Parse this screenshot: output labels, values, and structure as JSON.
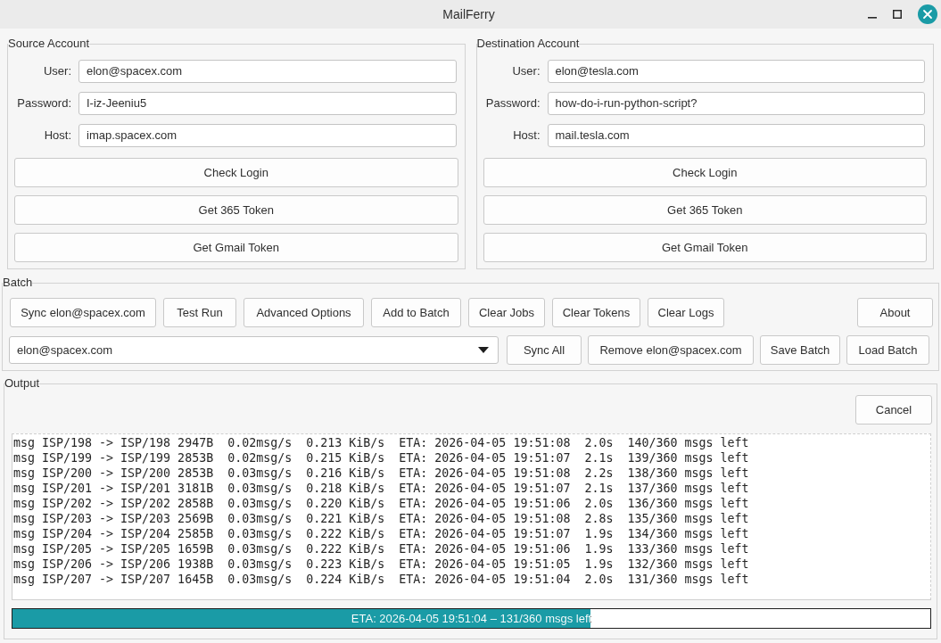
{
  "window": {
    "title": "MailFerry"
  },
  "source_account": {
    "title": "Source Account",
    "fields": [
      {
        "label": "User:",
        "value": "elon@spacex.com"
      },
      {
        "label": "Password:",
        "value": "I-iz-Jeeniu5"
      },
      {
        "label": "Host:",
        "value": "imap.spacex.com"
      }
    ],
    "buttons": [
      "Check Login",
      "Get 365 Token",
      "Get Gmail Token"
    ]
  },
  "destination_account": {
    "title": "Destination Account",
    "fields": [
      {
        "label": "User:",
        "value": "elon@tesla.com"
      },
      {
        "label": "Password:",
        "value": "how-do-i-run-python-script?"
      },
      {
        "label": "Host:",
        "value": "mail.tesla.com"
      }
    ],
    "buttons": [
      "Check Login",
      "Get 365 Token",
      "Get Gmail Token"
    ]
  },
  "batch": {
    "title": "Batch",
    "toolbar_buttons": [
      "Sync elon@spacex.com",
      "Test Run",
      "Advanced Options",
      "Add to Batch",
      "Clear Jobs",
      "Clear Tokens",
      "Clear Logs"
    ],
    "about_button": "About",
    "job_select": {
      "value": "elon@spacex.com"
    },
    "job_buttons": [
      "Sync All",
      "Remove elon@spacex.com",
      "Save Batch",
      "Load Batch"
    ]
  },
  "output": {
    "title": "Output",
    "cancel_button": "Cancel",
    "log_lines": [
      "msg ISP/198 -> ISP/198 2947B  0.02msg/s  0.213 KiB/s  ETA: 2026-04-05 19:51:08  2.0s  140/360 msgs left",
      "msg ISP/199 -> ISP/199 2853B  0.02msg/s  0.215 KiB/s  ETA: 2026-04-05 19:51:07  2.1s  139/360 msgs left",
      "msg ISP/200 -> ISP/200 2853B  0.03msg/s  0.216 KiB/s  ETA: 2026-04-05 19:51:08  2.2s  138/360 msgs left",
      "msg ISP/201 -> ISP/201 3181B  0.03msg/s  0.218 KiB/s  ETA: 2026-04-05 19:51:07  2.1s  137/360 msgs left",
      "msg ISP/202 -> ISP/202 2858B  0.03msg/s  0.220 KiB/s  ETA: 2026-04-05 19:51:06  2.0s  136/360 msgs left",
      "msg ISP/203 -> ISP/203 2569B  0.03msg/s  0.221 KiB/s  ETA: 2026-04-05 19:51:08  2.8s  135/360 msgs left",
      "msg ISP/204 -> ISP/204 2585B  0.03msg/s  0.222 KiB/s  ETA: 2026-04-05 19:51:07  1.9s  134/360 msgs left",
      "msg ISP/205 -> ISP/205 1659B  0.03msg/s  0.222 KiB/s  ETA: 2026-04-05 19:51:06  1.9s  133/360 msgs left",
      "msg ISP/206 -> ISP/206 1938B  0.03msg/s  0.223 KiB/s  ETA: 2026-04-05 19:51:05  1.9s  132/360 msgs left",
      "msg ISP/207 -> ISP/207 1645B  0.03msg/s  0.224 KiB/s  ETA: 2026-04-05 19:51:04  2.0s  131/360 msgs left"
    ],
    "progress": {
      "level": 0.63,
      "text": "ETA: 2026-04-05 19:51:04 – 131/360 msgs left"
    }
  }
}
